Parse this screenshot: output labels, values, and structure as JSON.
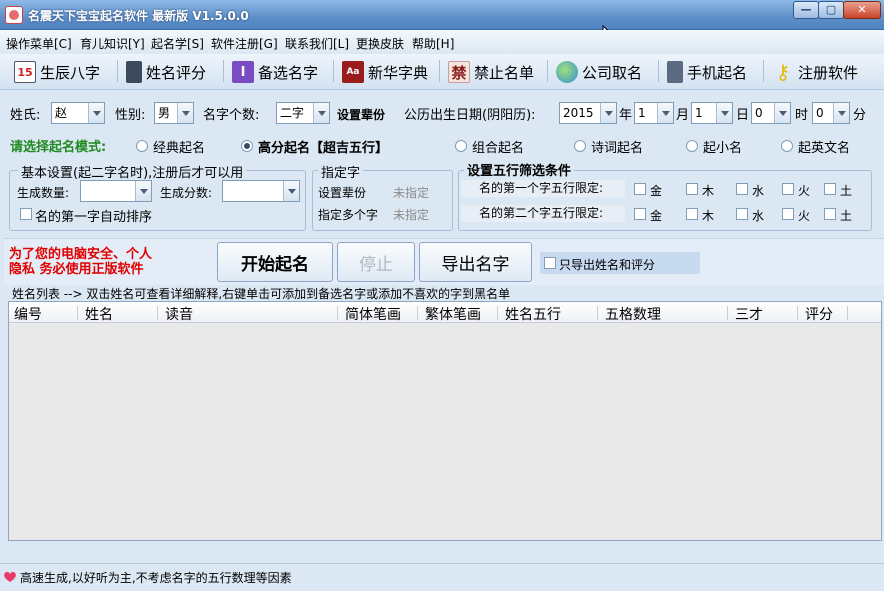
{
  "window": {
    "title": "名震天下宝宝起名软件 最新版 V1.5.0.0"
  },
  "menu": [
    {
      "label": "操作菜单[C]"
    },
    {
      "label": "育儿知识[Y]"
    },
    {
      "label": "起名学[S]"
    },
    {
      "label": "软件注册[G]"
    },
    {
      "label": "联系我们[L]"
    },
    {
      "label": "更换皮肤"
    },
    {
      "label": "帮助[H]"
    }
  ],
  "toolbar": [
    {
      "label": "生辰八字",
      "icon": "calendar-icon"
    },
    {
      "label": "姓名评分",
      "icon": "calculator-icon"
    },
    {
      "label": "备选名字",
      "icon": "notebook-icon"
    },
    {
      "label": "新华字典",
      "icon": "dictionary-icon"
    },
    {
      "label": "禁止名单",
      "icon": "forbidden-icon"
    },
    {
      "label": "公司取名",
      "icon": "globe-icon"
    },
    {
      "label": "手机起名",
      "icon": "phone-icon"
    },
    {
      "label": "注册软件",
      "icon": "key-icon"
    }
  ],
  "params": {
    "surname_label": "姓氏:",
    "surname_value": "赵",
    "gender_label": "性别:",
    "gender_value": "男",
    "name_len_label": "名字个数:",
    "name_len_value": "二字",
    "generation_label": "设置辈份",
    "birth_label": "公历出生日期(阴阳历):",
    "year_value": "2015",
    "year_unit": "年",
    "month_value": "1",
    "month_unit": "月",
    "day_value": "1",
    "day_unit": "日",
    "hour_value": "0",
    "hour_unit": "时",
    "minute_value": "0",
    "minute_unit": "分"
  },
  "mode": {
    "label": "请选择起名模式:",
    "options": [
      {
        "label": "经典起名",
        "selected": false
      },
      {
        "label": "高分起名【超吉五行】",
        "selected": true
      },
      {
        "label": "组合起名",
        "selected": false
      },
      {
        "label": "诗词起名",
        "selected": false
      },
      {
        "label": "起小名",
        "selected": false
      },
      {
        "label": "起英文名",
        "selected": false
      }
    ]
  },
  "basic": {
    "title": "基本设置(起二字名时),注册后才可以用",
    "count_label": "生成数量:",
    "score_label": "生成分数:",
    "sort_label": "名的第一字自动排序"
  },
  "assign": {
    "title": "指定字",
    "gen_label": "设置辈份",
    "gen_value": "未指定",
    "multi_label": "指定多个字",
    "multi_value": "未指定"
  },
  "wuxing": {
    "title": "设置五行筛选条件",
    "row1_label": "名的第一个字五行限定:",
    "row2_label": "名的第二个字五行限定:",
    "elements": [
      "金",
      "木",
      "水",
      "火",
      "土"
    ]
  },
  "notice": {
    "line1": "为了您的电脑安全、个人",
    "line2": "隐私 务必使用正版软件"
  },
  "actions": {
    "start": "开始起名",
    "stop": "停止",
    "export": "导出名字",
    "export_only_label": "只导出姓名和评分"
  },
  "list": {
    "hint": "姓名列表 --> 双击姓名可查看详细解释,右键单击可添加到备选名字或添加不喜欢的字到黑名单",
    "columns": [
      "编号",
      "姓名",
      "读音",
      "简体笔画",
      "繁体笔画",
      "姓名五行",
      "五格数理",
      "三才",
      "评分"
    ]
  },
  "status": {
    "text": "高速生成,以好听为主,不考虑名字的五行数理等因素"
  },
  "colors": {
    "accent_green": "#1f8a1f",
    "warning_red": "#e00000"
  }
}
